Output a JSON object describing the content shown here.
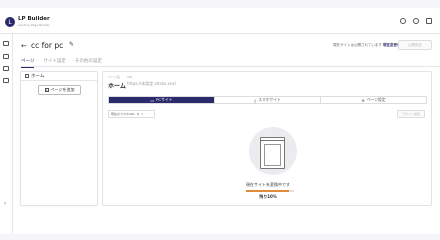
{
  "app": {
    "name": "LP Builder",
    "subtitle": "Landing Page Builder"
  },
  "header": {
    "back_icon": "arrow-left-icon",
    "title": "cc for pc",
    "edit_icon": "pencil-icon",
    "status_prefix": "現在サイトは公開されています",
    "status_emphasis": "現在変更中です",
    "publish_button": "公開設定"
  },
  "tabs": [
    {
      "label": "ページ",
      "active": true
    },
    {
      "label": "サイト設定",
      "active": false
    },
    {
      "label": "その他の設定",
      "active": false
    }
  ],
  "left_panel": {
    "header": "ホーム",
    "add_page_button": "ページを追加"
  },
  "right_panel": {
    "page_label": "ページ名",
    "url_label": "URL",
    "page_name": "ホーム",
    "url": "https://未設定.shalix.xxx/",
    "view_tabs": [
      {
        "label": "PCサイト",
        "active": true
      },
      {
        "label": "スマホサイト",
        "active": false
      },
      {
        "label": "ページ設定",
        "active": false
      }
    ],
    "preview_button": "現在のスマホURL",
    "design_button": "デザイン編集",
    "changing_text": "現在サイトを変換中です",
    "progress_label": "残り10%",
    "progress_fraction": 0.9
  },
  "colors": {
    "accent": "#2a2a6c",
    "progress": "#e08a3c"
  }
}
